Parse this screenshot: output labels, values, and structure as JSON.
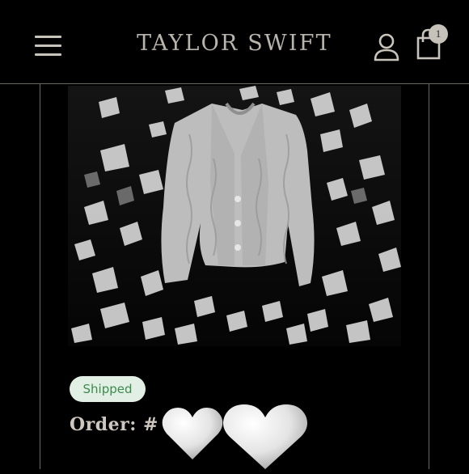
{
  "header": {
    "brand": "TAYLOR SWIFT",
    "menu_icon": "hamburger-menu-icon",
    "account_icon": "user-icon",
    "cart_icon": "shopping-bag-icon",
    "cart_count": "1"
  },
  "product": {
    "image": "cardigan-sweater-photo"
  },
  "order": {
    "status": "Shipped",
    "label": "Order: #",
    "heart_icon": "white-heart-icon",
    "status_color": "#3d8a4f",
    "status_bg": "#e2efe4"
  },
  "colors": {
    "background": "#000000",
    "brand_text": "#b9b4ac",
    "divider": "#6b6761"
  }
}
